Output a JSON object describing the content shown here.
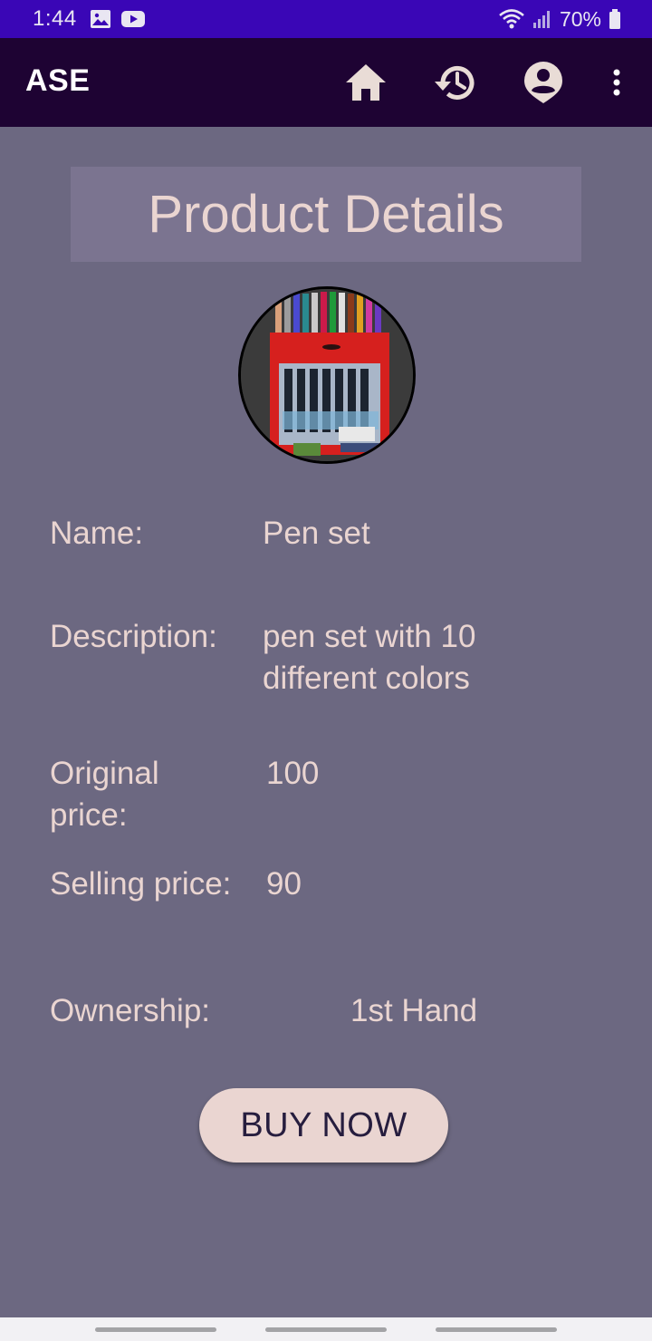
{
  "status_bar": {
    "time": "1:44",
    "battery": "70%",
    "icons": [
      "image-icon",
      "youtube-icon",
      "wifi-icon",
      "signal-icon",
      "battery-icon"
    ]
  },
  "app_bar": {
    "title": "ASE",
    "actions": [
      "home-icon",
      "history-icon",
      "account-icon",
      "more-vert-icon"
    ]
  },
  "page": {
    "title": "Product Details"
  },
  "product": {
    "name_label": "Name:",
    "name": "Pen set",
    "description_label": "Description:",
    "description_line1": "pen set with 10",
    "description_line2": "different colors",
    "original_price_label_line1": "Original",
    "original_price_label_line2": "price:",
    "original_price": "100",
    "selling_price_label": "Selling price:",
    "selling_price": "90",
    "ownership_label": "Ownership:",
    "ownership": "1st Hand"
  },
  "actions": {
    "buy_label": "BUY NOW"
  },
  "colors": {
    "status_bar": "#3a06b6",
    "app_bar": "#1e0333",
    "background": "#6c6881",
    "title_box": "#7b7490",
    "text": "#ead5d1",
    "button_bg": "#ead5d1",
    "button_text": "#261d3e"
  }
}
